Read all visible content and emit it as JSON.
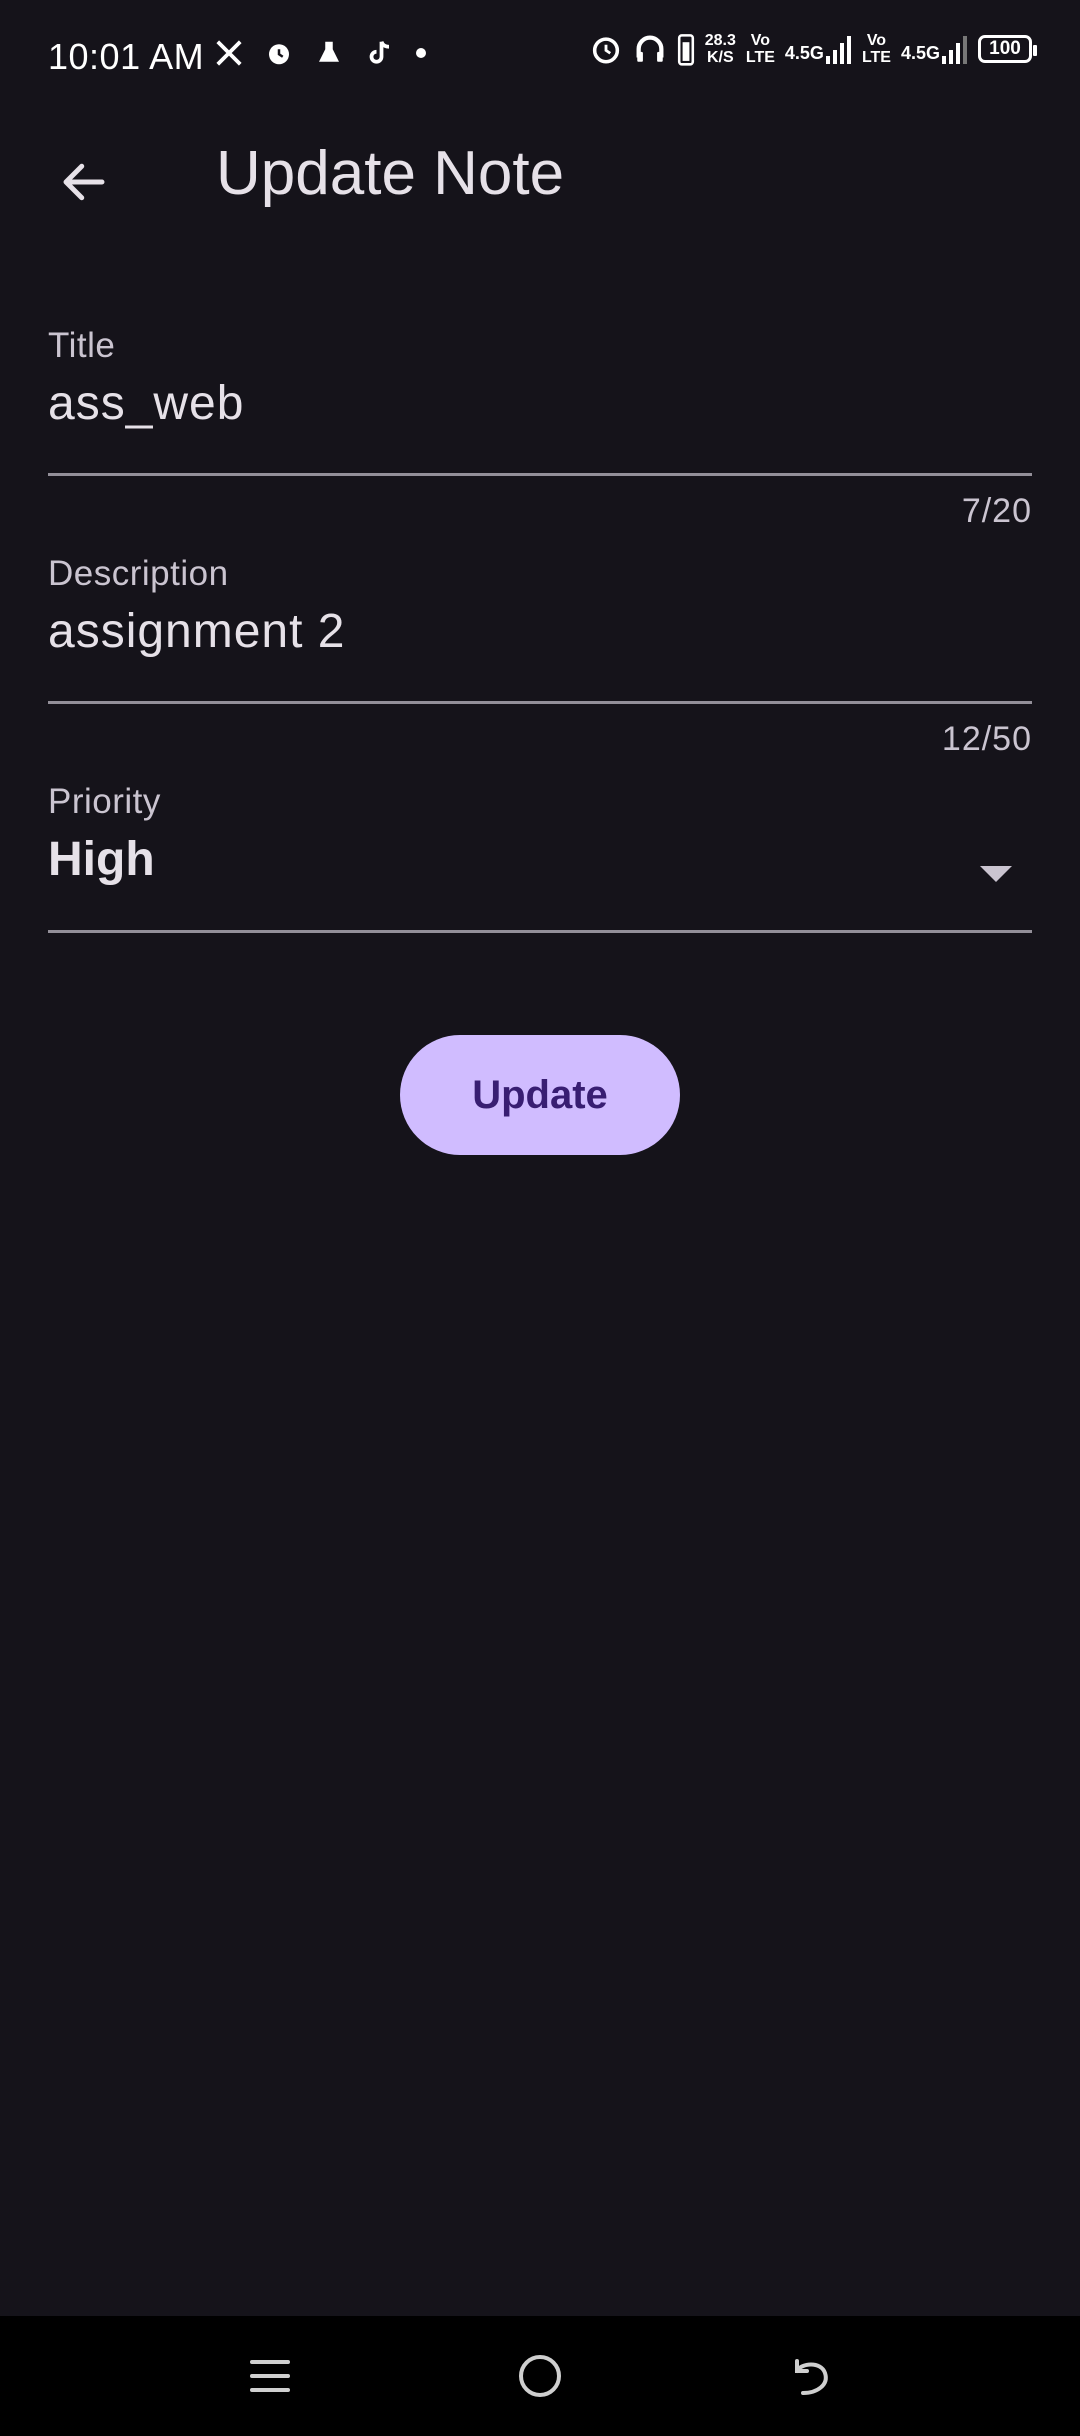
{
  "status_bar": {
    "time": "10:01 AM",
    "speed_value": "28.3",
    "speed_unit": "K/S",
    "volte_1_top": "Vo",
    "volte_1_bottom": "LTE",
    "net_1": "4.5G",
    "volte_2_top": "Vo",
    "volte_2_bottom": "LTE",
    "net_2": "4.5G",
    "battery": "100",
    "left_icons": [
      "x-icon",
      "alarm-icon",
      "flask-icon",
      "tiktok-icon",
      "dot-icon"
    ],
    "right_icons": [
      "alarm-icon",
      "headphones-icon",
      "battery-saver-icon",
      "signal-icon",
      "signal-icon"
    ]
  },
  "app_bar": {
    "title": "Update Note",
    "back_icon": "arrow-left-icon"
  },
  "form": {
    "title_field": {
      "label": "Title",
      "value": "ass_web",
      "counter": "7/20"
    },
    "description_field": {
      "label": "Description",
      "value": "assignment 2",
      "counter": "12/50"
    },
    "priority_field": {
      "label": "Priority",
      "value": "High"
    },
    "submit_label": "Update"
  },
  "colors": {
    "background": "#15131a",
    "button": "#d0bcff",
    "button_text": "#381e72",
    "underline": "#938f99"
  },
  "nav_bar": {
    "icons": [
      "menu-icon",
      "home-icon",
      "back-icon"
    ]
  }
}
